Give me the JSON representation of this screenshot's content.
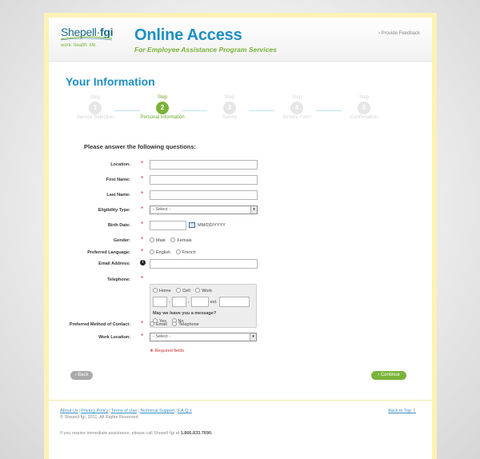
{
  "brand": {
    "logo_name": "Shepell",
    "logo_suffix": "fgi",
    "logo_tagline": "work. health. life.",
    "app_title": "Online Access",
    "app_subtitle": "For Employee Assistance Program Services",
    "feedback": "› Provide Feedback"
  },
  "page_title": "Your Information",
  "steps": [
    {
      "top": "Step",
      "number": "1",
      "label": "Service Selection"
    },
    {
      "top": "Step",
      "number": "2",
      "label": "Personal Information",
      "active": true
    },
    {
      "top": "Step",
      "number": "3",
      "label": "Survey"
    },
    {
      "top": "Step",
      "number": "4",
      "label": "Service Form"
    },
    {
      "top": "Step",
      "number": "5",
      "label": "Confirmation"
    }
  ],
  "form": {
    "intro": "Please answer the following questions:",
    "location": {
      "label": "Location:",
      "value": ""
    },
    "first_name": {
      "label": "First Name:",
      "value": ""
    },
    "last_name": {
      "label": "Last Name:",
      "value": ""
    },
    "eligibility": {
      "label": "Eligibility Type:",
      "selected": "- Select -"
    },
    "birth_date": {
      "label": "Birth Date:",
      "format": "MM/DD/YYYY"
    },
    "gender": {
      "label": "Gender:",
      "options": [
        "Male",
        "Female"
      ]
    },
    "language": {
      "label": "Preferred Language:",
      "options": [
        "English",
        "French"
      ]
    },
    "email": {
      "label": "Email Address:",
      "value": ""
    },
    "telephone": {
      "label": "Telephone:",
      "types": [
        "Home",
        "Cell",
        "Work"
      ],
      "dash": "-",
      "ext_label": "ext.",
      "message_question": "May we leave you a message?",
      "message_options": [
        "Yes",
        "No"
      ]
    },
    "contact_method": {
      "label": "Preferred Method of Contact:",
      "options": [
        "Email",
        "Telephone"
      ]
    },
    "work_location": {
      "label": "Work Location:",
      "selected": "- Select -"
    },
    "required_note": "★ Required fields",
    "required_mark": "*",
    "dropdown_arrow": "▾",
    "info_icon_glyph": "i"
  },
  "buttons": {
    "back": "‹ Back",
    "continue": "› Continue"
  },
  "footer": {
    "links": [
      "About Us",
      "Privacy Policy",
      "Terms of Use",
      "Technical Support",
      "F.A.Q.s"
    ],
    "separator": "|",
    "copyright": "© Shepell·fgi, 2011. All Rights Reserved",
    "back_to_top": "Back to Top",
    "back_to_top_icon": "⇑",
    "assist_text": "If you require immediate assistance, please call Shepell·fgi at ",
    "assist_phone": "1.866.833.7690."
  },
  "colors": {
    "brand_blue": "#1e8fc3",
    "brand_green": "#7ab33a",
    "required_red": "#d0302b",
    "frame_yellow": "#fbf2b5"
  }
}
